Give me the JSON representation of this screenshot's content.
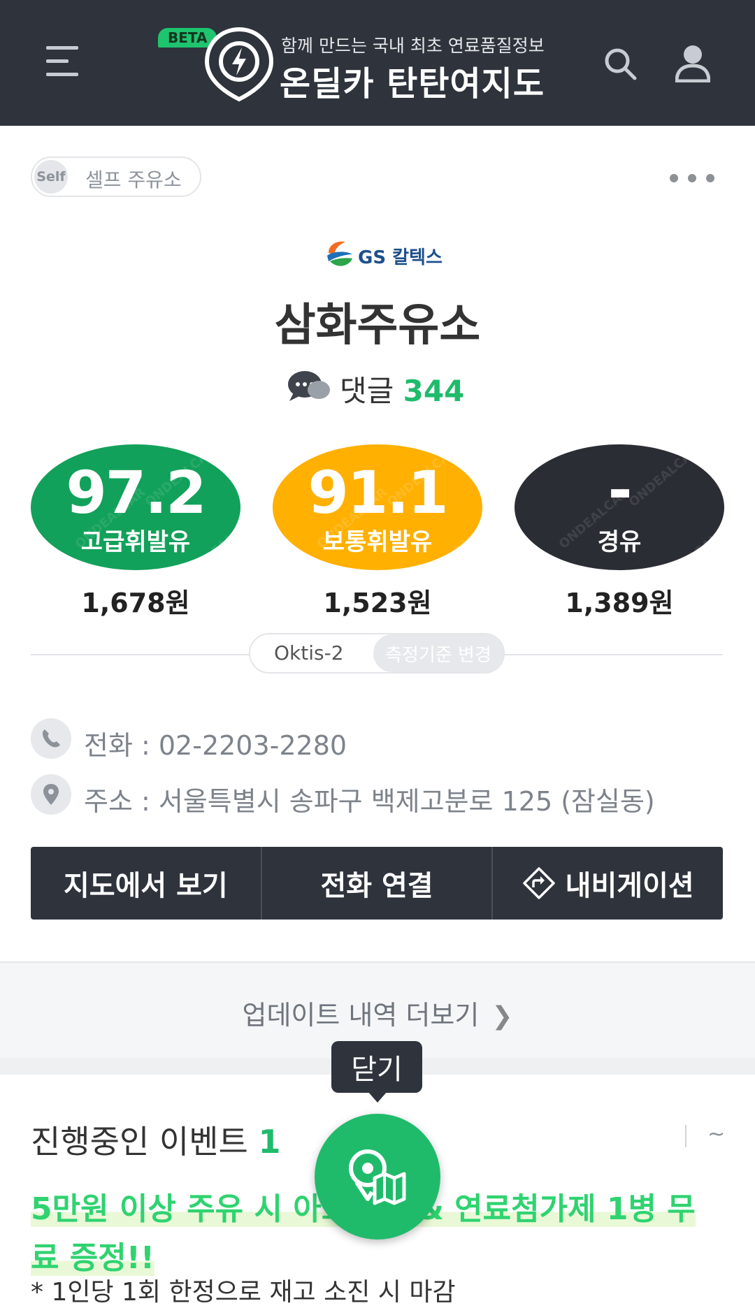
{
  "header": {
    "beta": "BETA",
    "tagline": "함께 만드는 국내 최초 연료품질정보",
    "app_name": "온딜카 탄탄여지도"
  },
  "station": {
    "self_badge_icon": "Self",
    "self_label": "셀프 주유소",
    "brand": "GS 칼텍스",
    "name": "삼화주유소",
    "comments_label": "댓글",
    "comments_count": "344"
  },
  "fuels": [
    {
      "score": "97.2",
      "name": "고급휘발유",
      "price": "1,678원",
      "color": "#12a15a"
    },
    {
      "score": "91.1",
      "name": "보통휘발유",
      "price": "1,523원",
      "color": "#ffb000"
    },
    {
      "score": "-",
      "name": "경유",
      "price": "1,389원",
      "color": "#2a2d33"
    }
  ],
  "standard": {
    "current": "Oktis-2",
    "change_label": "측정기준 변경"
  },
  "contact": {
    "phone": "전화 : 02-2203-2280",
    "address": "주소 : 서울특별시 송파구 백제고분로 125 (잠실동)"
  },
  "actions": {
    "map": "지도에서 보기",
    "call": "전화 연결",
    "navigation": "내비게이션"
  },
  "update": {
    "more": "업데이트 내역 더보기"
  },
  "tooltip": "닫기",
  "event": {
    "title": "진행중인 이벤트",
    "count": "1",
    "toggle": "~",
    "text": "5만원 이상 주유 시 아드블루 & 연료첨가제 1병 무료 증정!!",
    "sub": "* 1인당 1회 한정으로 재고 소진 시 마감"
  },
  "icons": [
    "menu-icon",
    "search-icon",
    "user-icon",
    "more-icon",
    "phone-icon",
    "location-icon",
    "navigation-icon",
    "chevron-right-icon",
    "map-fab-icon",
    "comment-icon"
  ]
}
